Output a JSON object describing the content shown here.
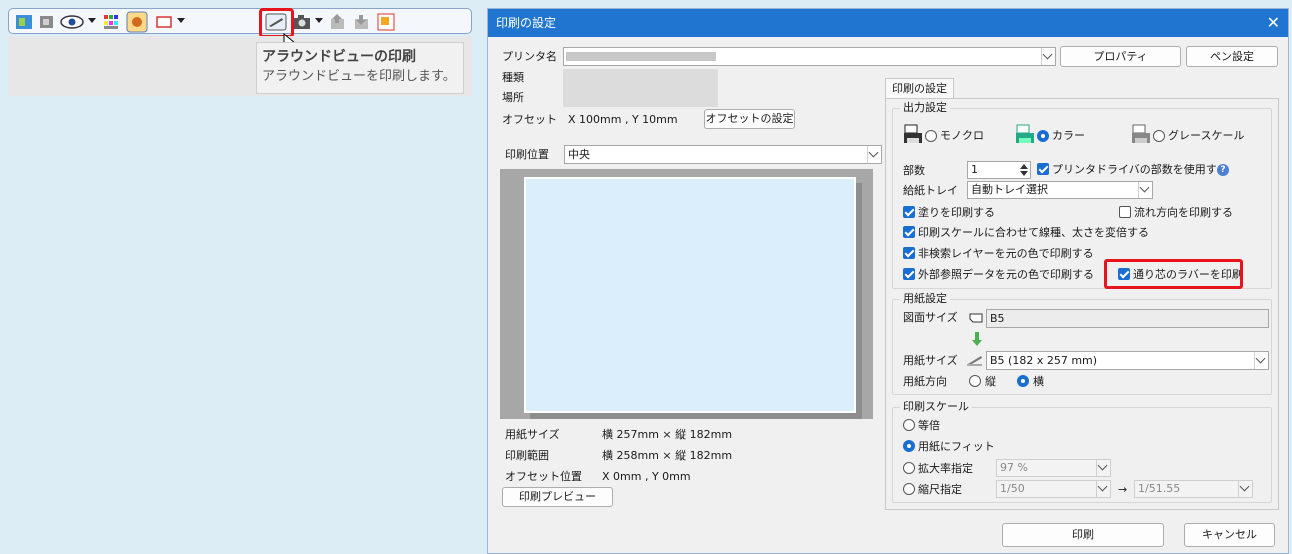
{
  "tooltip": {
    "title": "アラウンドビューの印刷",
    "description": "アラウンドビューを印刷します。"
  },
  "dialog": {
    "title": "印刷の設定",
    "printer": {
      "name_label": "プリンタ名",
      "type_label": "種類",
      "location_label": "場所",
      "properties_button": "プロパティ",
      "pen_settings_button": "ペン設定"
    },
    "offset": {
      "label": "オフセット",
      "value": "X 100mm , Y 10mm",
      "button": "オフセットの設定"
    },
    "print_position": {
      "label": "印刷位置",
      "value": "中央"
    },
    "info": {
      "paper_size_label": "用紙サイズ",
      "paper_size_value": "横 257mm × 縦 182mm",
      "print_range_label": "印刷範囲",
      "print_range_value": "横 258mm × 縦 182mm",
      "offset_pos_label": "オフセット位置",
      "offset_pos_value": "X 0mm , Y 0mm"
    },
    "preview_button": "印刷プレビュー",
    "tab": "印刷の設定",
    "output": {
      "title": "出力設定",
      "mono": "モノクロ",
      "color": "カラー",
      "grayscale": "グレースケール",
      "copies_label": "部数",
      "copies_value": "1",
      "use_driver_copies": "プリンタドライバの部数を使用する",
      "tray_label": "給紙トレイ",
      "tray_value": "自動トレイ選択",
      "fill": "塗りを印刷する",
      "flow": "流れ方向を印刷する",
      "scale_line": "印刷スケールに合わせて線種、太さを変倍する",
      "non_search": "非検索レイヤーを元の色で印刷する",
      "xref": "外部参照データを元の色で印刷する",
      "gridline_label": "通り芯のラバーを印刷"
    },
    "paper": {
      "title": "用紙設定",
      "drawing_size_label": "図面サイズ",
      "drawing_size_value": "B5",
      "paper_size_label": "用紙サイズ",
      "paper_size_value": "B5 (182 x 257 mm)",
      "orientation_label": "用紙方向",
      "portrait": "縦",
      "landscape": "横"
    },
    "scale": {
      "title": "印刷スケール",
      "equal": "等倍",
      "fit": "用紙にフィット",
      "zoom_label": "拡大率指定",
      "zoom_value": "97 %",
      "scale_label": "縮尺指定",
      "scale_value": "1/50",
      "arrow": "→",
      "scale_result": "1/51.55"
    },
    "print_button": "印刷",
    "cancel_button": "キャンセル"
  }
}
